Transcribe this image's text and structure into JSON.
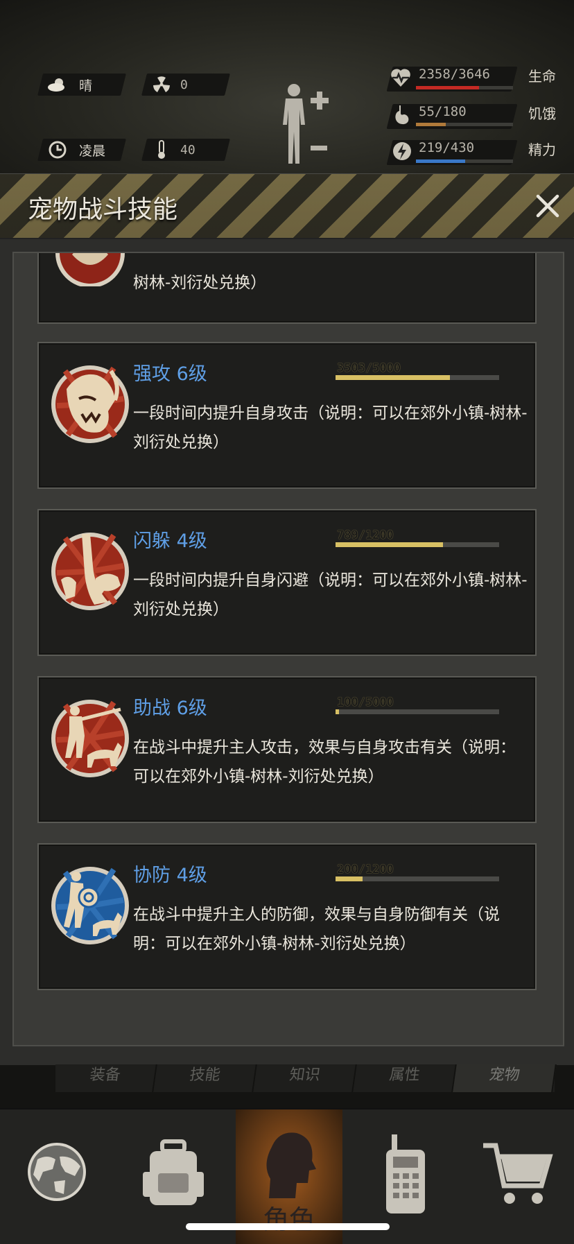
{
  "status": {
    "weather": "晴",
    "radiation": "0",
    "time_of_day": "凌晨",
    "temperature": "40"
  },
  "vitals": [
    {
      "name": "生命",
      "value": "2358/3646",
      "fraction": 0.647,
      "color": "#c42a24"
    },
    {
      "name": "饥饿",
      "value": "55/180",
      "fraction": 0.306,
      "color": "#b07a3a"
    },
    {
      "name": "精力",
      "value": "219/430",
      "fraction": 0.509,
      "color": "#3a78c8"
    }
  ],
  "panel": {
    "title": "宠物战斗技能"
  },
  "skills": [
    {
      "title": "",
      "desc": "一段时间内提升自身防御（说明：可以在郊外小镇-树林-刘衍处兑换）",
      "desc_visible_tail": "树林-刘衍处兑换）",
      "xp": "",
      "fraction": 0
    },
    {
      "title": "强攻 6级",
      "xp": "3503/5000",
      "fraction": 0.7006,
      "desc": "一段时间内提升自身攻击（说明：可以在郊外小镇-树林-刘衍处兑换）",
      "icon": "beast-attack-icon"
    },
    {
      "title": "闪躲 4级",
      "xp": "789/1200",
      "fraction": 0.6575,
      "desc": "一段时间内提升自身闪避（说明：可以在郊外小镇-树林-刘衍处兑换）",
      "icon": "dodge-tree-icon"
    },
    {
      "title": "助战 6级",
      "xp": "100/5000",
      "fraction": 0.02,
      "desc": "在战斗中提升主人攻击，效果与自身攻击有关（说明：可以在郊外小镇-树林-刘衍处兑换）",
      "icon": "hunter-dog-icon"
    },
    {
      "title": "协防 4级",
      "xp": "200/1200",
      "fraction": 0.1667,
      "desc": "在战斗中提升主人的防御，效果与自身防御有关（说明：可以在郊外小镇-树林-刘衍处兑换）",
      "icon": "shield-dog-icon"
    }
  ],
  "subtabs": [
    "装备",
    "技能",
    "知识",
    "属性",
    "宠物"
  ],
  "active_subtab": "宠物",
  "nav": {
    "role_label": "角色"
  }
}
